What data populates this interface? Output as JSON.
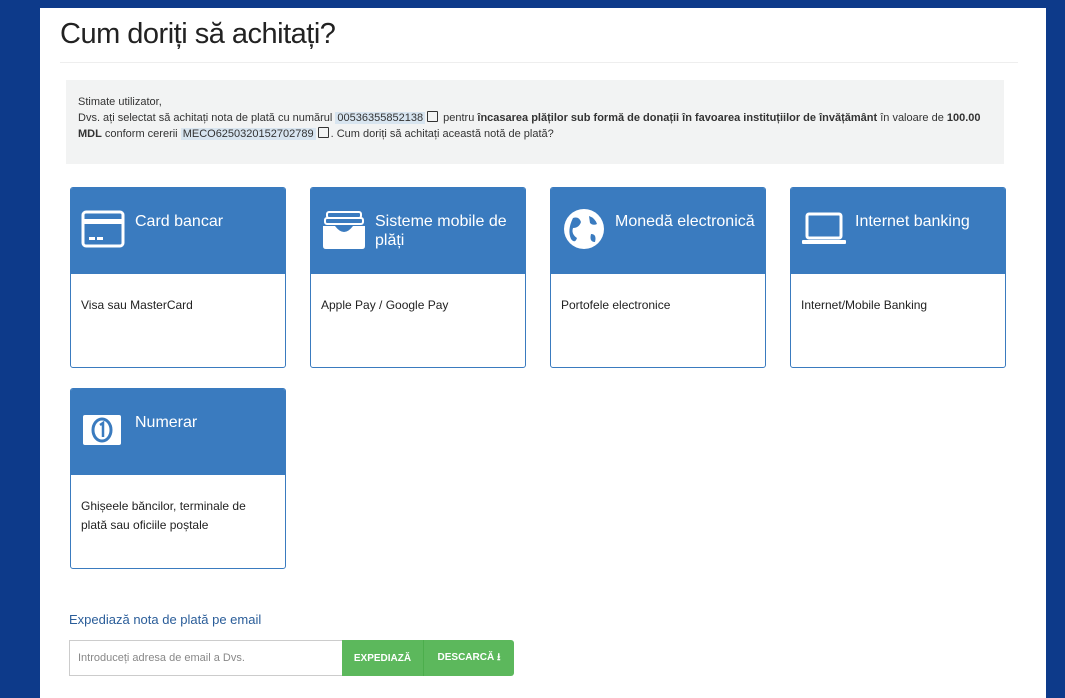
{
  "page": {
    "title": "Cum doriți să achitați?"
  },
  "notice": {
    "greeting": "Stimate utilizator,",
    "text_1": "Dvs. ați selectat să achitați nota de plată cu numărul ",
    "invoice_number": "00536355852138",
    "text_2": " pentru ",
    "purpose": "încasarea plăților sub formă de donații în favoarea instituțiilor de învățământ",
    "text_3": " în valoare de ",
    "amount": "100.00 MDL",
    "text_4": " conform cererii ",
    "request_id": "MECO6250320152702789",
    "text_5": ". Cum doriți să achitați această notă de plată?"
  },
  "methods": [
    {
      "label": "Card bancar",
      "description": "Visa sau MasterCard",
      "icon": "credit-card-icon"
    },
    {
      "label": "Sisteme mobile de plăți",
      "description": "Apple Pay / Google Pay",
      "icon": "wallet-icon"
    },
    {
      "label": "Monedă electronică",
      "description": "Portofele electronice",
      "icon": "globe-icon"
    },
    {
      "label": "Internet banking",
      "description": "Internet/Mobile Banking",
      "icon": "laptop-icon"
    },
    {
      "label": "Numerar",
      "description": "Ghișeele băncilor, terminale de plată sau oficiile poștale",
      "icon": "cash-icon"
    }
  ],
  "email": {
    "section_title": "Expediază nota de plată pe email",
    "placeholder": "Introduceți adresa de email a Dvs.",
    "send_label": "EXPEDIAZĂ",
    "download_label": "DESCARCĂ ⭳"
  },
  "colors": {
    "background": "#0d3a8a",
    "card_header": "#3a7bbf",
    "button_green": "#5cb85c"
  }
}
